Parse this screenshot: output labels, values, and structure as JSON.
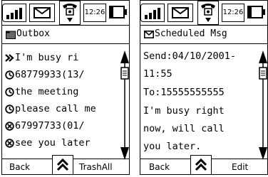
{
  "status": {
    "time": "12:26"
  },
  "outbox": {
    "title": "Outbox",
    "items": [
      {
        "icon": "double-arrow-icon",
        "text": "I'm busy ri"
      },
      {
        "icon": "clock-icon",
        "text": "68779933(13/"
      },
      {
        "icon": "clock-icon",
        "text": "the meeting"
      },
      {
        "icon": "clock-icon",
        "text": "please call me"
      },
      {
        "icon": "x-circle-icon",
        "text": "67997733(01/"
      },
      {
        "icon": "x-circle-icon",
        "text": "see you later"
      }
    ],
    "softkeys": {
      "left": "Back",
      "right": "TrashAll"
    }
  },
  "scheduled": {
    "title": "Scheduled Msg",
    "lines": [
      "Send:04/10/2001-",
      "11:55",
      "To:15555555555",
      "I'm busy right",
      "now, will call",
      "you later."
    ],
    "softkeys": {
      "left": "Back",
      "right": "Edit"
    }
  }
}
